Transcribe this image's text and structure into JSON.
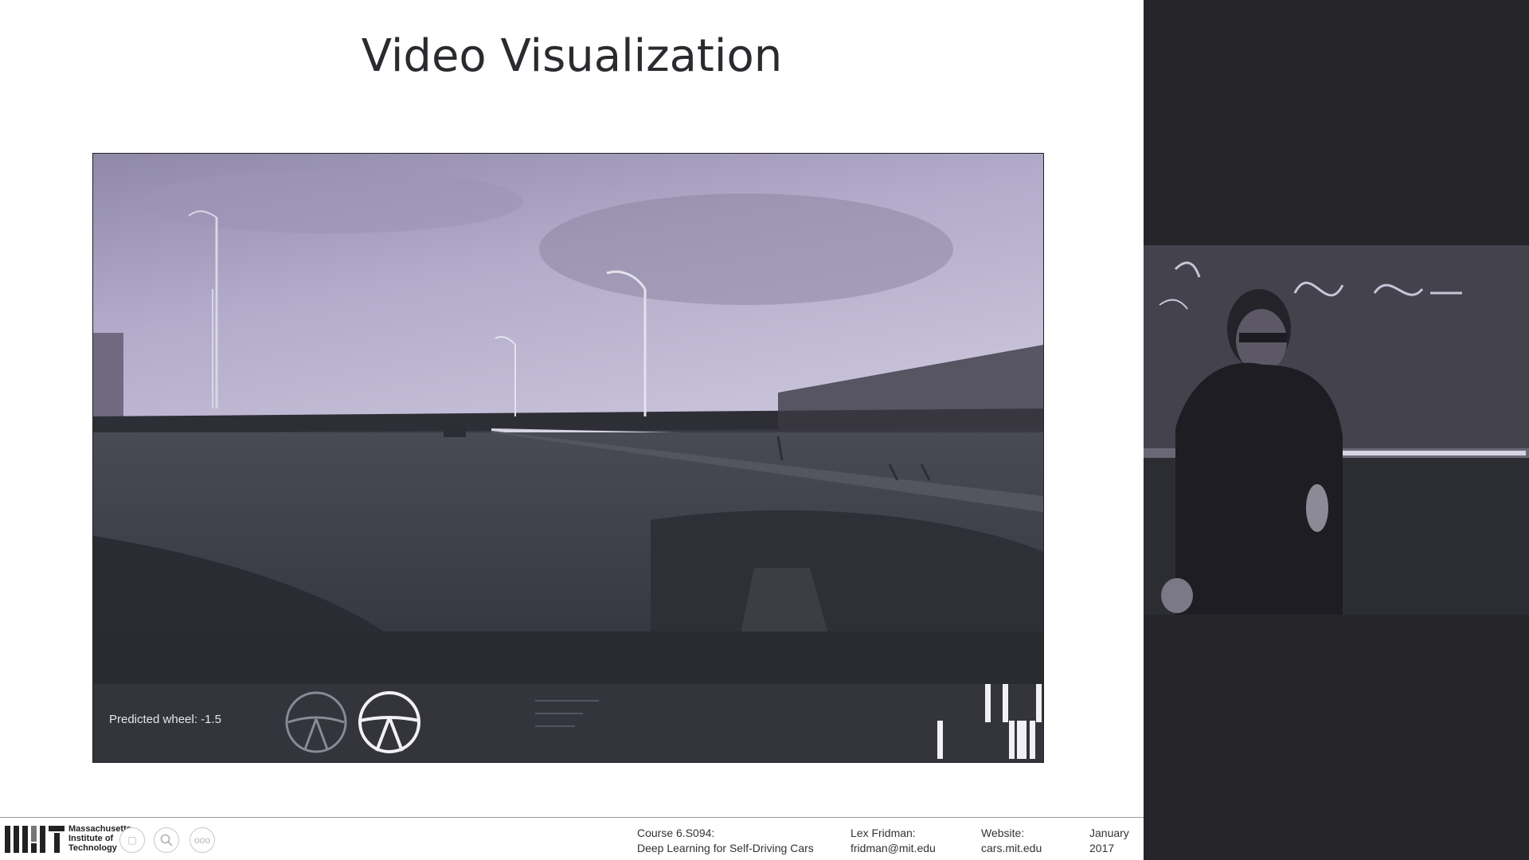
{
  "slide": {
    "title": "Video Visualization",
    "hud": {
      "predicted_label": "Predicted wheel: -1.5"
    }
  },
  "footer": {
    "mit_name": [
      "Massachusetts",
      "Institute of",
      "Technology"
    ],
    "controls": [
      {
        "icon": "page-icon"
      },
      {
        "icon": "search-icon"
      },
      {
        "icon": "more-icon",
        "label": "ooo"
      }
    ],
    "course": {
      "line1": "Course 6.S094:",
      "line2": "Deep Learning for Self-Driving Cars"
    },
    "author": {
      "line1": "Lex Fridman:",
      "line2": "fridman@mit.edu"
    },
    "website": {
      "line1": "Website:",
      "line2": "cars.mit.edu"
    },
    "date": {
      "line1": "January",
      "line2": "2017"
    }
  },
  "colors": {
    "slide_bg": "#ffffff",
    "side_bg": "#25252a",
    "sky": "#a9a1c2",
    "road": "#3f3f49",
    "hud_bg": "#34343c"
  }
}
